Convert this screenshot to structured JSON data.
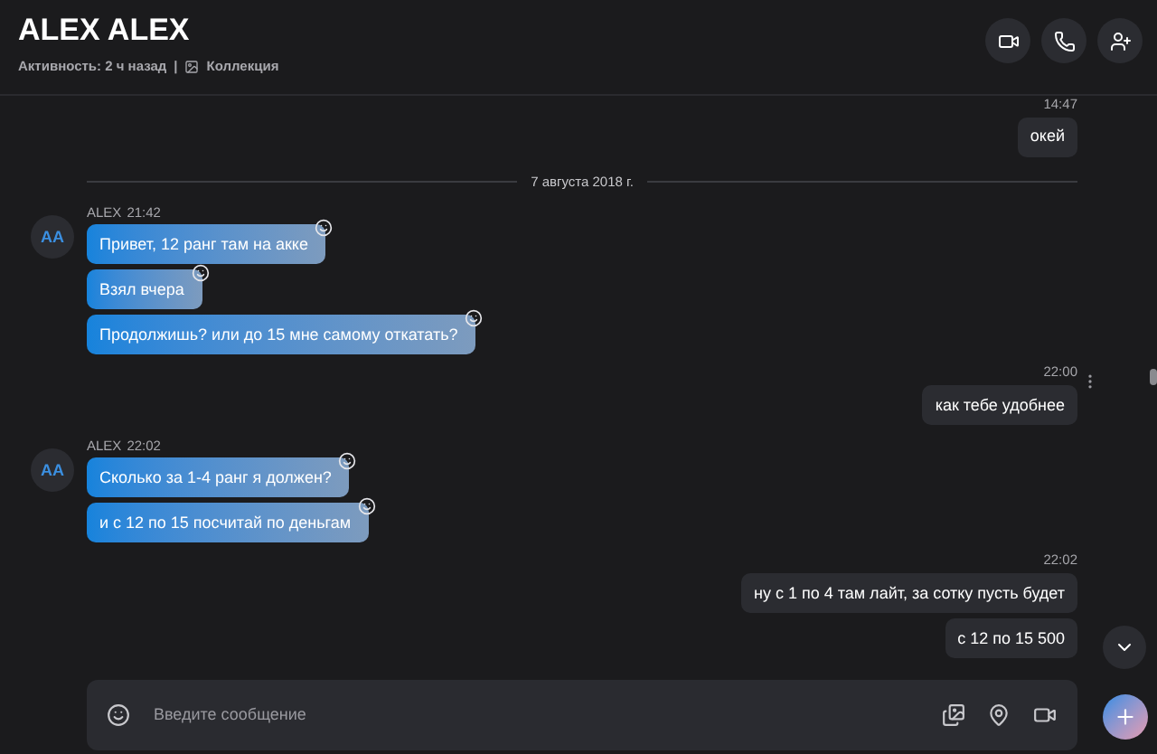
{
  "header": {
    "name": "ALEX ALEX",
    "status": "Активность: 2 ч назад",
    "separator": "|",
    "collection": "Коллекция"
  },
  "header_buttons": [
    {
      "kind": "video"
    },
    {
      "kind": "call"
    },
    {
      "kind": "add_person"
    }
  ],
  "messages": [
    {
      "kind": "outgoing",
      "time": "14:47",
      "bubbles": [
        "окей"
      ]
    },
    {
      "kind": "date",
      "text": "7 августа 2018 г."
    },
    {
      "kind": "incoming",
      "avatar": "AA",
      "sender": "ALEX",
      "time": "21:42",
      "bubbles": [
        "Привет, 12 ранг там на акке",
        "Взял вчера",
        "Продолжишь? или до 15 мне самому откатать?"
      ]
    },
    {
      "kind": "outgoing",
      "time": "22:00",
      "bubbles": [
        "как тебе удобнее"
      ]
    },
    {
      "kind": "incoming",
      "avatar": "AA",
      "sender": "ALEX",
      "time": "22:02",
      "bubbles": [
        "Сколько за 1-4 ранг я должен?",
        "и с 12 по 15 посчитай по деньгам"
      ]
    },
    {
      "kind": "outgoing",
      "time": "22:02",
      "bubbles": [
        "ну с 1 по 4 там лайт, за сотку пусть будет",
        "с 12 по 15 500"
      ]
    }
  ],
  "composer": {
    "placeholder": "Введите сообщение"
  }
}
